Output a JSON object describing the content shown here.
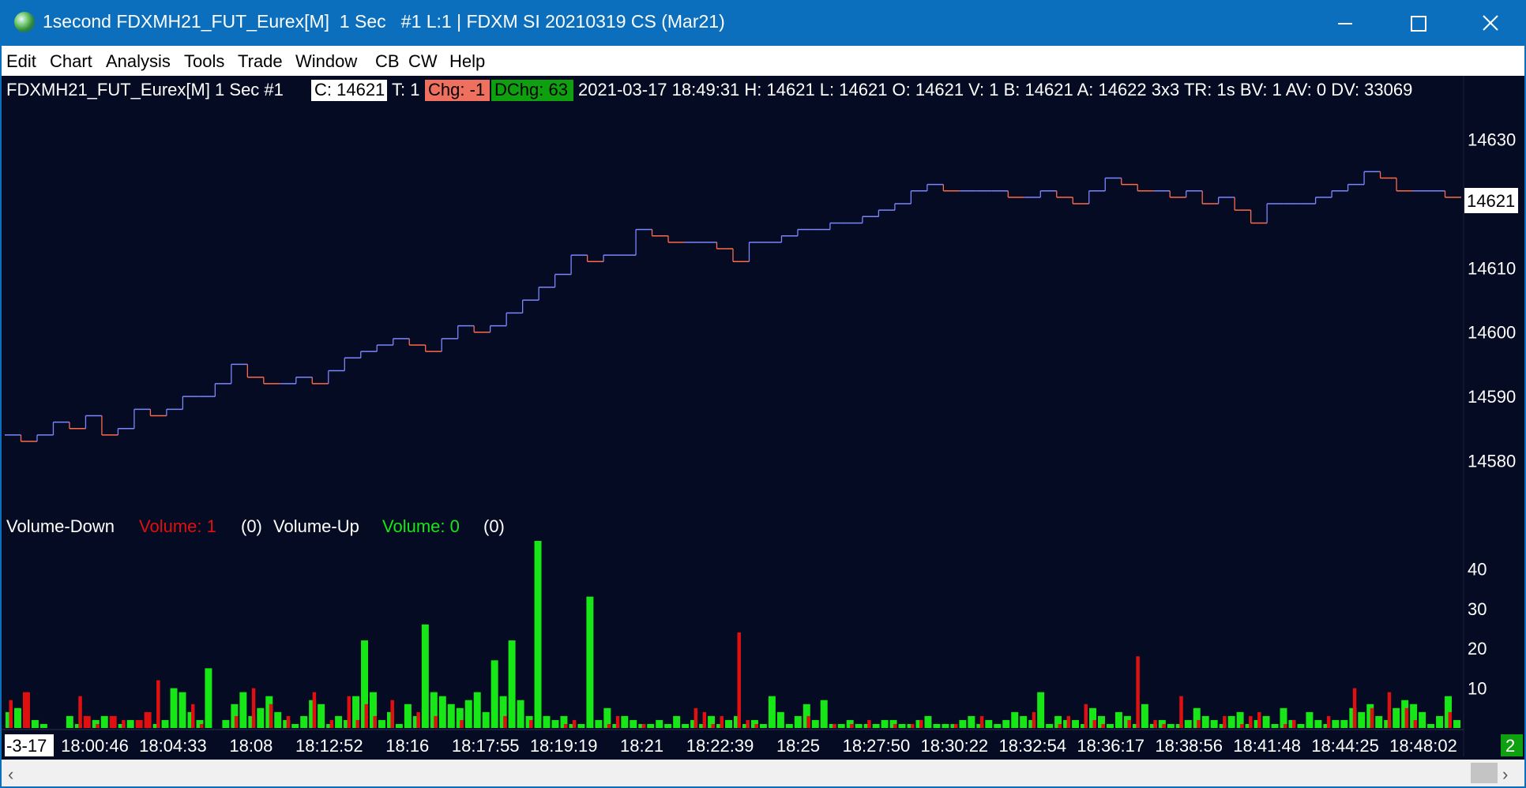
{
  "window": {
    "title": "1second FDXMH21_FUT_Eurex[M]  1 Sec   #1 L:1 | FDXM SI 20210319 CS (Mar21)",
    "close_glyph": "×"
  },
  "menu": [
    "Edit",
    "Chart",
    "Analysis",
    "Tools",
    "Trade",
    "Window",
    "CB",
    "CW",
    "Help"
  ],
  "header": {
    "symbol": "FDXMH21_FUT_Eurex[M]   1 Sec    #1",
    "close_label": "C: 14621",
    "ticks": "T: 1",
    "chg": "Chg: -1",
    "dchg": "DChg: 63",
    "details": "2021-03-17 18:49:31 H: 14621 L: 14621 O: 14621 V: 1 B: 14621 A: 14622 3x3 TR: 1s BV: 1 AV: 0 DV: 33069"
  },
  "volume_legend": {
    "down_name": "Volume-Down",
    "down_value": "Volume: 1",
    "down_paren": "(0)",
    "up_name": "Volume-Up",
    "up_value": "Volume: 0",
    "up_paren": "(0)"
  },
  "corner_date": "-3-17",
  "corner_badge": "2",
  "last_price_label": "14621",
  "colors": {
    "background": "#040b22",
    "up": "#7b86ff",
    "down": "#ff6a4a",
    "volume_up": "#17e617",
    "volume_down": "#e01010",
    "chg_bg": "#f07060",
    "dchg_bg": "#0fa010"
  },
  "chart_data": [
    {
      "type": "line",
      "name": "price",
      "ylim": [
        14576,
        14635
      ],
      "yticks": [
        14580,
        14590,
        14600,
        14610,
        14620,
        14630
      ],
      "values": [
        14584,
        14583,
        14584,
        14586,
        14585,
        14587,
        14584,
        14585,
        14588,
        14587,
        14588,
        14590,
        14590,
        14592,
        14595,
        14593,
        14592,
        14592,
        14593,
        14592,
        14594,
        14596,
        14597,
        14598,
        14599,
        14598,
        14597,
        14599,
        14601,
        14600,
        14601,
        14603,
        14605,
        14607,
        14609,
        14612,
        14611,
        14612,
        14612,
        14616,
        14615,
        14614,
        14614,
        14614,
        14613,
        14611,
        14614,
        14614,
        14615,
        14616,
        14616,
        14617,
        14617,
        14618,
        14619,
        14620,
        14622,
        14623,
        14622,
        14622,
        14622,
        14622,
        14621,
        14621,
        14622,
        14621,
        14620,
        14622,
        14624,
        14623,
        14622,
        14622,
        14621,
        14622,
        14620,
        14621,
        14619,
        14617,
        14620,
        14620,
        14620,
        14621,
        14622,
        14623,
        14625,
        14624,
        14622,
        14622,
        14622,
        14621
      ]
    },
    {
      "type": "bar",
      "name": "volume",
      "ylim": [
        0,
        48
      ],
      "yticks": [
        10,
        20,
        30,
        40
      ],
      "xticks": [
        "18:00:46",
        "18:04:33",
        "18:08",
        "18:12:52",
        "18:16",
        "18:17:55",
        "18:19:19",
        "18:21",
        "18:22:39",
        "18:25",
        "18:27:50",
        "18:30:22",
        "18:32:54",
        "18:36:17",
        "18:38:56",
        "18:41:48",
        "18:44:25",
        "18:48:02"
      ],
      "up": [
        4,
        5,
        0,
        2,
        1,
        0,
        0,
        3,
        1,
        0,
        2,
        3,
        0,
        1,
        2,
        0,
        0,
        1,
        2,
        10,
        9,
        4,
        2,
        15,
        0,
        2,
        6,
        9,
        3,
        5,
        8,
        4,
        2,
        1,
        3,
        7,
        6,
        1,
        3,
        2,
        8,
        22,
        9,
        2,
        4,
        1,
        6,
        3,
        26,
        9,
        8,
        6,
        5,
        7,
        9,
        4,
        17,
        8,
        22,
        7,
        3,
        47,
        3,
        2,
        3,
        1,
        1,
        33,
        2,
        5,
        1,
        3,
        2,
        1,
        1,
        2,
        1,
        3,
        1,
        2,
        1,
        3,
        1,
        2,
        3,
        1,
        2,
        1,
        8,
        4,
        1,
        3,
        6,
        2,
        7,
        1,
        1,
        2,
        1,
        1,
        1,
        2,
        2,
        1,
        1,
        2,
        3,
        1,
        1,
        1,
        2,
        3,
        1,
        2,
        1,
        2,
        4,
        3,
        2,
        9,
        1,
        3,
        2,
        2,
        1,
        5,
        3,
        1,
        4,
        3,
        1,
        6,
        1,
        2,
        1,
        1,
        2,
        5,
        3,
        2,
        1,
        3,
        4,
        1,
        2,
        3,
        1,
        5,
        2,
        1,
        4,
        2,
        1,
        2,
        2,
        5,
        4,
        6,
        3,
        2,
        5,
        7,
        6,
        4,
        1,
        3,
        8,
        2
      ],
      "down": [
        7,
        0,
        9,
        0,
        0,
        0,
        0,
        0,
        8,
        3,
        1,
        0,
        3,
        2,
        0,
        2,
        4,
        12,
        0,
        0,
        0,
        6,
        1,
        0,
        0,
        0,
        3,
        0,
        10,
        0,
        6,
        0,
        3,
        0,
        0,
        9,
        0,
        2,
        0,
        8,
        2,
        6,
        3,
        0,
        7,
        0,
        0,
        4,
        0,
        3,
        0,
        0,
        2,
        0,
        0,
        0,
        0,
        3,
        0,
        0,
        2,
        0,
        0,
        0,
        1,
        2,
        0,
        0,
        0,
        1,
        3,
        0,
        0,
        1,
        0,
        0,
        0,
        0,
        0,
        5,
        4,
        1,
        3,
        0,
        24,
        2,
        1,
        0,
        0,
        0,
        0,
        0,
        3,
        0,
        0,
        1,
        0,
        1,
        0,
        2,
        0,
        0,
        1,
        0,
        1,
        2,
        0,
        0,
        0,
        1,
        0,
        0,
        3,
        0,
        0,
        0,
        0,
        0,
        4,
        0,
        0,
        1,
        3,
        0,
        6,
        2,
        1,
        0,
        0,
        2,
        18,
        0,
        2,
        1,
        0,
        8,
        0,
        2,
        0,
        0,
        3,
        0,
        1,
        3,
        4,
        0,
        0,
        1,
        2,
        0,
        0,
        0,
        3,
        0,
        0,
        10,
        0,
        5,
        0,
        9,
        0,
        5,
        2,
        0,
        0,
        0,
        4,
        0
      ]
    }
  ]
}
